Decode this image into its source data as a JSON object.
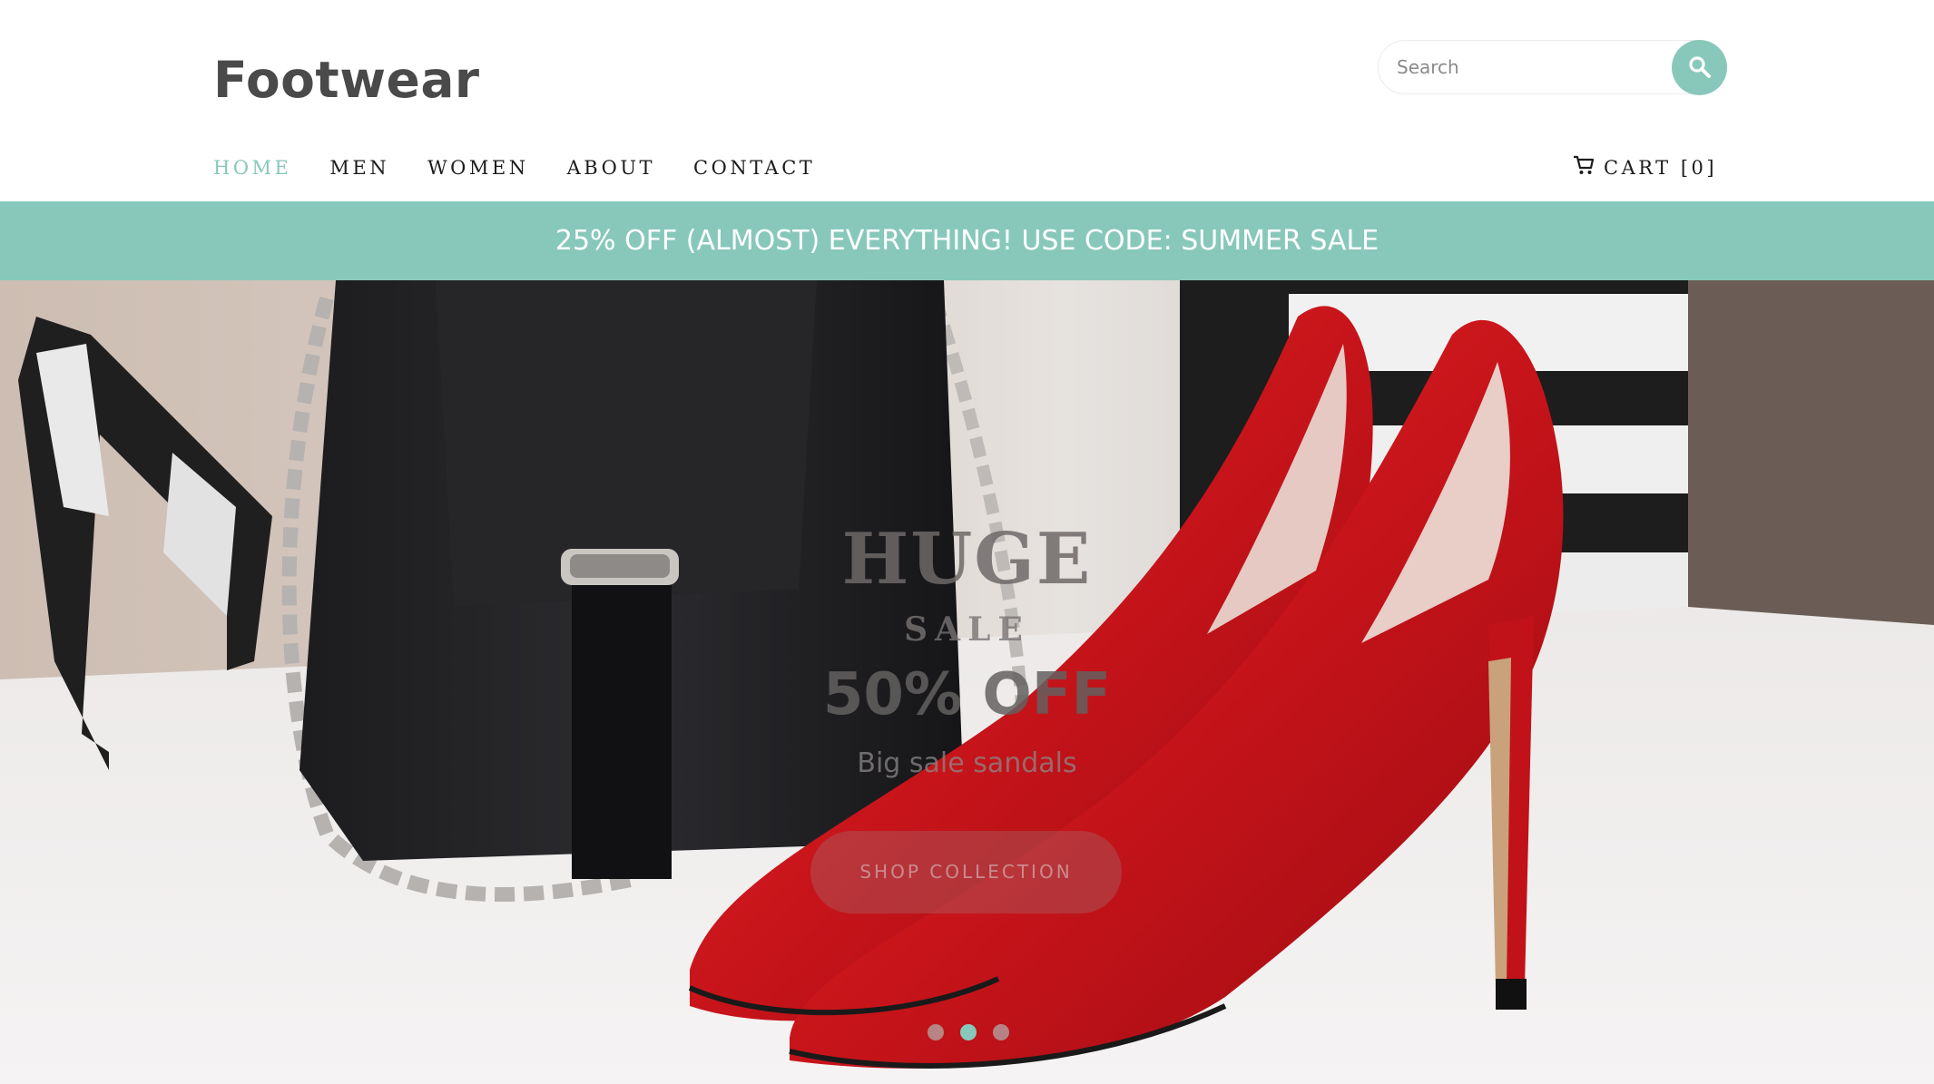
{
  "header": {
    "logo": "Footwear",
    "search_placeholder": "Search",
    "nav": [
      {
        "label": "HOME",
        "active": true
      },
      {
        "label": "MEN",
        "active": false
      },
      {
        "label": "WOMEN",
        "active": false
      },
      {
        "label": "ABOUT",
        "active": false
      },
      {
        "label": "CONTACT",
        "active": false
      }
    ],
    "cart_label": "CART [0]"
  },
  "promo": {
    "text": "25% OFF (ALMOST) EVERYTHING! USE CODE: SUMMER SALE"
  },
  "hero": {
    "title": "HUGE",
    "subtitle": "SALE",
    "offer": "50% OFF",
    "description": "Big sale sandals",
    "button_label": "SHOP COLLECTION",
    "slides": 3,
    "active_slide": 2
  },
  "colors": {
    "accent": "#88c8bb",
    "text_dark": "#1c1c1c",
    "logo": "#4a4a4a"
  },
  "icons": {
    "search": "search-icon",
    "cart": "cart-icon"
  }
}
